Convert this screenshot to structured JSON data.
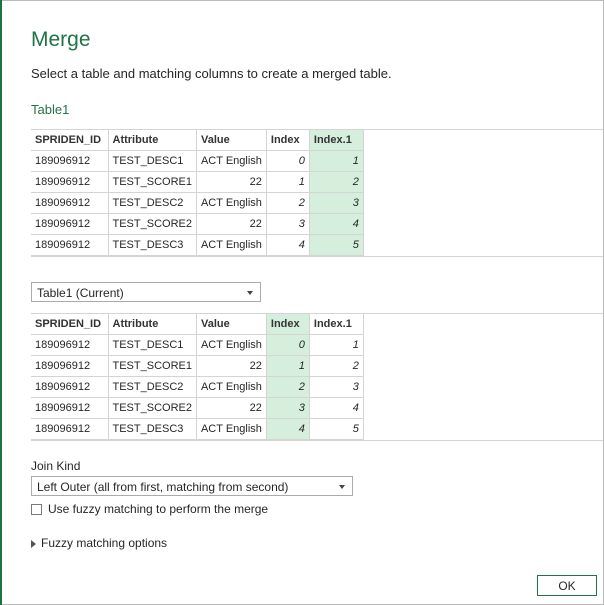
{
  "dialog": {
    "title": "Merge",
    "subtitle": "Select a table and matching columns to create a merged table.",
    "table1_label": "Table1"
  },
  "grid_top": {
    "columns": [
      "SPRIDEN_ID",
      "Attribute",
      "Value",
      "Index",
      "Index.1"
    ],
    "selected_column": "Index.1",
    "rows": [
      [
        "189096912",
        "TEST_DESC1",
        "ACT English",
        "0",
        "1"
      ],
      [
        "189096912",
        "TEST_SCORE1",
        "22",
        "1",
        "2"
      ],
      [
        "189096912",
        "TEST_DESC2",
        "ACT English",
        "2",
        "3"
      ],
      [
        "189096912",
        "TEST_SCORE2",
        "22",
        "3",
        "4"
      ],
      [
        "189096912",
        "TEST_DESC3",
        "ACT English",
        "4",
        "5"
      ]
    ]
  },
  "table_select": {
    "value": "Table1 (Current)"
  },
  "grid_bottom": {
    "columns": [
      "SPRIDEN_ID",
      "Attribute",
      "Value",
      "Index",
      "Index.1"
    ],
    "selected_column": "Index",
    "rows": [
      [
        "189096912",
        "TEST_DESC1",
        "ACT English",
        "0",
        "1"
      ],
      [
        "189096912",
        "TEST_SCORE1",
        "22",
        "1",
        "2"
      ],
      [
        "189096912",
        "TEST_DESC2",
        "ACT English",
        "2",
        "3"
      ],
      [
        "189096912",
        "TEST_SCORE2",
        "22",
        "3",
        "4"
      ],
      [
        "189096912",
        "TEST_DESC3",
        "ACT English",
        "4",
        "5"
      ]
    ]
  },
  "join": {
    "label": "Join Kind",
    "value": "Left Outer (all from first, matching from second)"
  },
  "fuzzy": {
    "checkbox_label": "Use fuzzy matching to perform the merge",
    "checked": false,
    "options_label": "Fuzzy matching options"
  },
  "buttons": {
    "ok": "OK"
  }
}
